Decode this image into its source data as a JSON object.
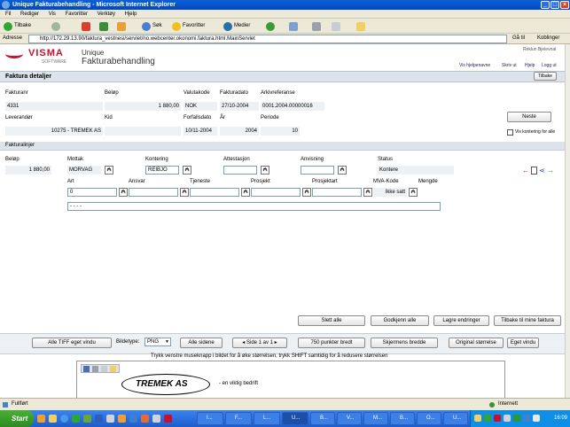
{
  "window": {
    "title": "Unique Fakturabehandling - Microsoft Internet Explorer"
  },
  "menu": [
    "Fil",
    "Rediger",
    "Vis",
    "Favoritter",
    "Verktøy",
    "Hjelp"
  ],
  "toolbar": {
    "back": "Tilbake",
    "search": "Søk",
    "favorites": "Favoritter",
    "media": "Medier"
  },
  "address": {
    "label": "Adresse",
    "url": "http://172.29.13.90/faktura_vestnesi/servlet/no.webcenter.okonomi.faktura.html.MainServlet",
    "go": "Gå til",
    "links": "Koblinger"
  },
  "brand": {
    "logo": "VISMA",
    "logo_sub": "SOFTWARE",
    "app_line1": "Unique",
    "app_line2": "Fakturabehandling",
    "user": "Reklun Bjelevnal",
    "links": [
      "Vis hjelpenavne",
      "Skriv ut",
      "Hjelp",
      "Logg ut"
    ]
  },
  "section": {
    "title": "Faktura detaljer",
    "back_button": "Tilbake",
    "lines_title": "Fakturalinjer"
  },
  "invoice": {
    "labels": {
      "fakturanr": "Fakturanr",
      "belop": "Beløp",
      "valutakode": "Valutakode",
      "fakturadato": "Fakturadato",
      "arkivreferanse": "Arkivreferanse",
      "leverandor": "Leverandør",
      "kid": "Kid",
      "forfallsdato": "Forfallsdato",
      "ar": "År",
      "periode": "Periode"
    },
    "fakturanr": "4331",
    "belop": "1 880,00",
    "valutakode": "NOK",
    "fakturadato": "27/10-2004",
    "arkivreferanse": "0001.2004.00000016",
    "leverandor": "10275 - TREMEK AS",
    "kid": "",
    "forfallsdato": "10/11-2004",
    "ar": "2004",
    "periode": "10",
    "next_button": "Neste",
    "show_kontering": "Vis kontering for alle"
  },
  "line": {
    "labels": {
      "belop": "Beløp",
      "mottak": "Mottak",
      "kontering": "Kontering",
      "attestasjon": "Attestasjon",
      "anvisning": "Anvisning",
      "status": "Status",
      "art": "Art",
      "ansvar": "Ansvar",
      "tjeneste": "Tjeneste",
      "prosjekt": "Prosjekt",
      "prosjektart": "Prosjektart",
      "mva_kode": "MVA-Kode",
      "mengde": "Mengde"
    },
    "belop": "1 880,00",
    "mottak": "MORVAG",
    "kontering": "REIBJO",
    "attestasjon": "",
    "anvisning": "",
    "status": "Kontere",
    "art": "0",
    "ansvar": "",
    "tjeneste": "",
    "prosjekt": "",
    "prosjektart": "",
    "mva_kode": "Ikke satt",
    "mengde": "",
    "comment": "- - - -"
  },
  "actions": [
    "Slett alle",
    "Godkjenn alle",
    "Lagre endringer",
    "Tilbake til mine faktura"
  ],
  "viewer": {
    "all_tiff": "Alle TIFF eget vindu",
    "image_type_label": "Bildetype:",
    "image_type": "PNG",
    "all_pages": "Alle sidene",
    "page": "Side 1 av 1",
    "width_750": "750 punkter bredt",
    "screen_width": "Skjermens bredde",
    "original": "Original størrelse",
    "own_window": "Eget vindu",
    "hint": "Trykk venstre museknapp i bildet for å øke størrelsen, trykk SHIFT samtidig for å redusere størrelsen",
    "doc_title": "TREMEK AS",
    "doc_tagline": "- en viktig bedrift"
  },
  "status": {
    "left": "Fullført",
    "zone": "Internett"
  },
  "taskbar": {
    "start": "Start",
    "tasks": [
      "I...",
      "F...",
      "L...",
      "U...",
      "B...",
      "V...",
      "M...",
      "B...",
      "O...",
      "U..."
    ],
    "clock": "16:09"
  }
}
